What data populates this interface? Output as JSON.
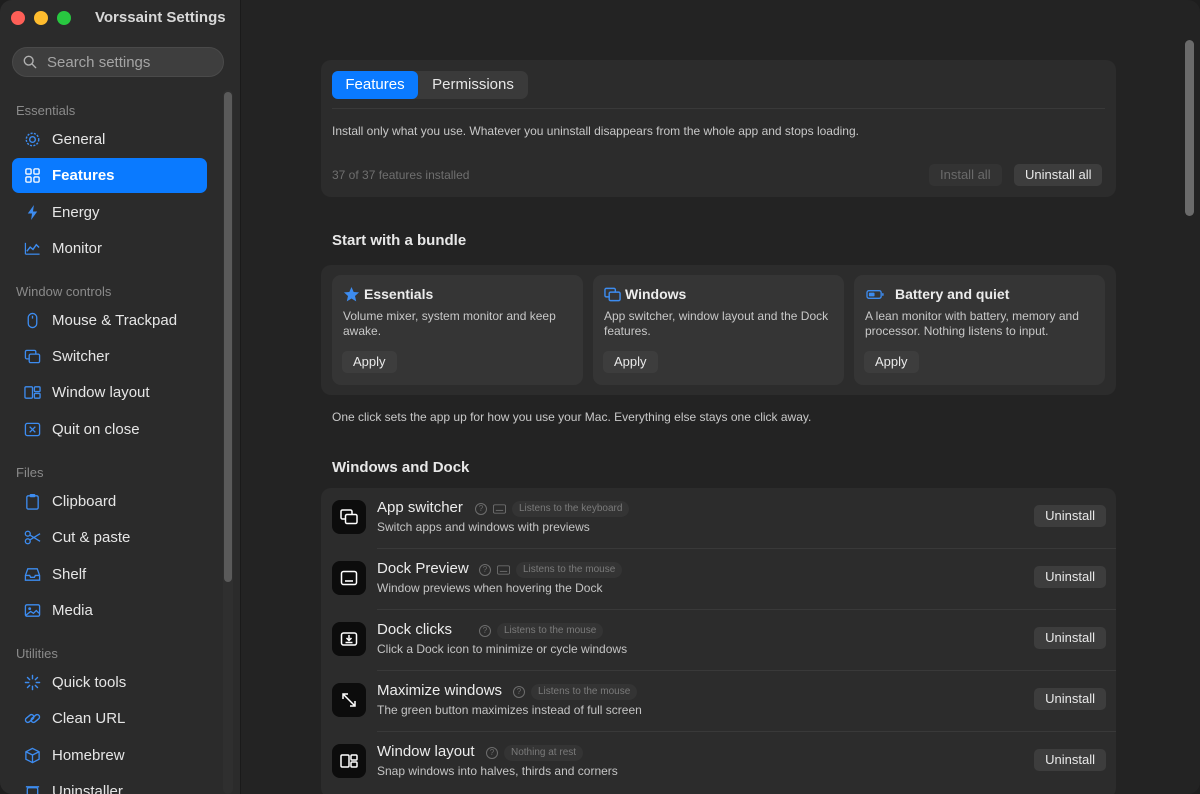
{
  "window": {
    "title": "Vorssaint Settings"
  },
  "search": {
    "placeholder": "Search settings"
  },
  "sidebar": {
    "sections": [
      {
        "label": "Essentials",
        "items": [
          {
            "label": "General",
            "icon": "gear-icon"
          },
          {
            "label": "Features",
            "icon": "grid-icon",
            "active": true
          },
          {
            "label": "Energy",
            "icon": "bolt-icon"
          },
          {
            "label": "Monitor",
            "icon": "chart-icon"
          }
        ]
      },
      {
        "label": "Window controls",
        "items": [
          {
            "label": "Mouse & Trackpad",
            "icon": "mouse-icon"
          },
          {
            "label": "Switcher",
            "icon": "windows-icon"
          },
          {
            "label": "Window layout",
            "icon": "layout-icon"
          },
          {
            "label": "Quit on close",
            "icon": "close-box-icon"
          }
        ]
      },
      {
        "label": "Files",
        "items": [
          {
            "label": "Clipboard",
            "icon": "clipboard-icon"
          },
          {
            "label": "Cut & paste",
            "icon": "scissors-icon"
          },
          {
            "label": "Shelf",
            "icon": "tray-icon"
          },
          {
            "label": "Media",
            "icon": "photo-icon"
          }
        ]
      },
      {
        "label": "Utilities",
        "items": [
          {
            "label": "Quick tools",
            "icon": "sparkle-icon"
          },
          {
            "label": "Clean URL",
            "icon": "link-icon"
          },
          {
            "label": "Homebrew",
            "icon": "cube-icon"
          },
          {
            "label": "Uninstaller",
            "icon": "trash-icon"
          }
        ]
      }
    ]
  },
  "tabs": {
    "features": "Features",
    "permissions": "Permissions"
  },
  "intro": {
    "description": "Install only what you use. Whatever you uninstall disappears from the whole app and stops loading.",
    "count": "37 of 37 features installed",
    "install_all": "Install all",
    "uninstall_all": "Uninstall all"
  },
  "bundles": {
    "heading": "Start with a bundle",
    "items": [
      {
        "title": "Essentials",
        "icon": "star-icon",
        "text": "Volume mixer, system monitor and keep awake.",
        "button": "Apply"
      },
      {
        "title": "Windows",
        "icon": "windows-icon",
        "text": "App switcher, window layout and the Dock features.",
        "button": "Apply"
      },
      {
        "title": "Battery and quiet",
        "icon": "battery-icon",
        "text": "A lean monitor with battery, memory and processor. Nothing listens to input.",
        "button": "Apply"
      }
    ],
    "footnote": "One click sets the app up for how you use your Mac. Everything else stays one click away."
  },
  "dock": {
    "heading": "Windows and Dock",
    "rows": [
      {
        "name": "App switcher",
        "sub": "Switch apps and windows with previews",
        "badge": "Listens to the keyboard",
        "keyboard": true,
        "button": "Uninstall",
        "icon": "app-switcher-icon"
      },
      {
        "name": "Dock Preview",
        "sub": "Window previews when hovering the Dock",
        "badge": "Listens to the mouse",
        "keyboard": true,
        "button": "Uninstall",
        "icon": "dock-preview-icon"
      },
      {
        "name": "Dock clicks",
        "sub": "Click a Dock icon to minimize or cycle windows",
        "badge": "Listens to the mouse",
        "keyboard": false,
        "button": "Uninstall",
        "icon": "dock-clicks-icon"
      },
      {
        "name": "Maximize windows",
        "sub": "The green button maximizes instead of full screen",
        "badge": "Listens to the mouse",
        "keyboard": false,
        "button": "Uninstall",
        "icon": "maximize-icon"
      },
      {
        "name": "Window layout",
        "sub": "Snap windows into halves, thirds and corners",
        "badge": "Nothing at rest",
        "keyboard": false,
        "button": "Uninstall",
        "icon": "window-layout-icon"
      }
    ]
  },
  "colors": {
    "accent": "#0a7aff",
    "sidebar": "#2b2b2b",
    "main": "#232323"
  }
}
